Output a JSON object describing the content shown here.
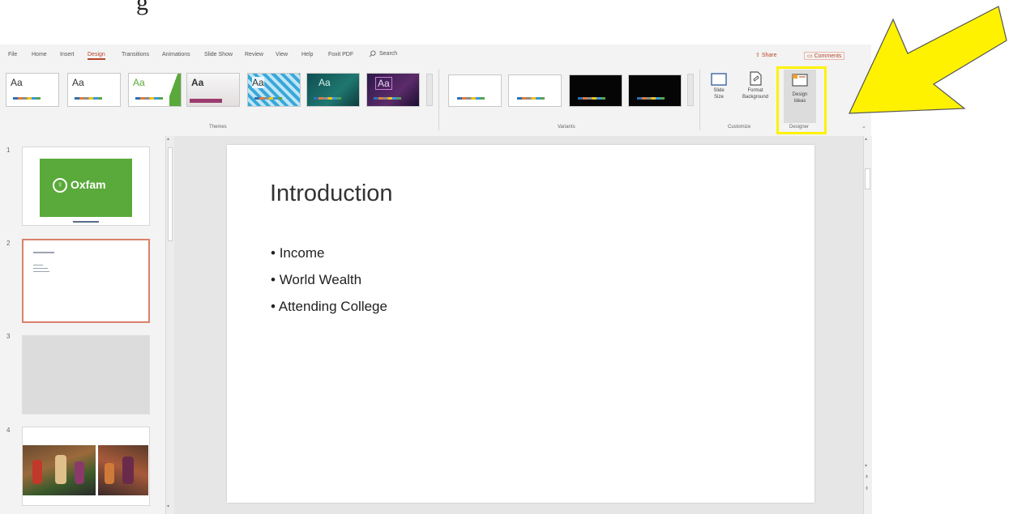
{
  "heading_fragment": "g",
  "tabs": [
    "File",
    "Home",
    "Insert",
    "Design",
    "Transitions",
    "Animations",
    "Slide Show",
    "Review",
    "View",
    "Help",
    "Foxit PDF"
  ],
  "active_tab": "Design",
  "search": {
    "label": "Search"
  },
  "share_label": "Share",
  "comments_label": "Comments",
  "ribbon": {
    "themes_label": "Themes",
    "variants_label": "Variants",
    "customize_label": "Customize",
    "designer_label": "Designer",
    "theme_aa": [
      "Aa",
      "Aa",
      "Aa",
      "Aa",
      "Aa",
      "Aa",
      "Aa"
    ],
    "slide_size": {
      "line1": "Slide",
      "line2": "Size"
    },
    "format_background": {
      "line1": "Format",
      "line2": "Background"
    },
    "design_ideas": {
      "line1": "Design",
      "line2": "Ideas"
    }
  },
  "slides": [
    {
      "number": "1",
      "title": "Oxfam"
    },
    {
      "number": "2"
    },
    {
      "number": "3"
    },
    {
      "number": "4"
    }
  ],
  "current_slide": {
    "title": "Introduction",
    "bullets": [
      "Income",
      "World Wealth",
      "Attending College"
    ]
  },
  "colors": {
    "accent": "#b7472a",
    "oxfam_green": "#5aaa3b",
    "highlight": "#fff200"
  }
}
